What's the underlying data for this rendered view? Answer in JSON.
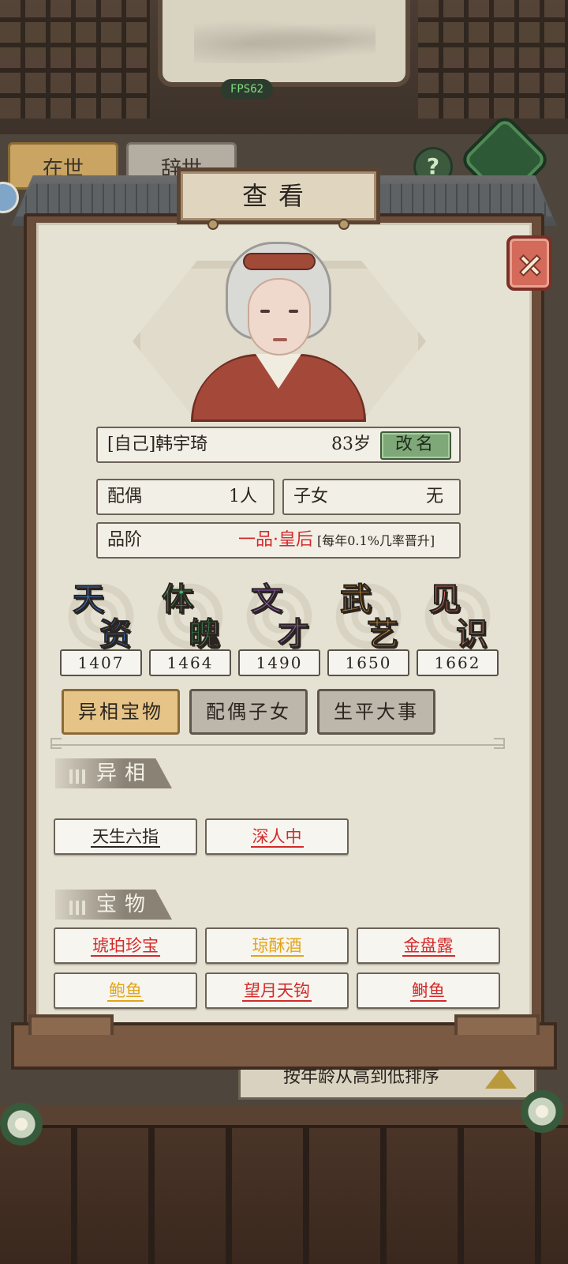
{
  "status": {
    "fps": "FPS62"
  },
  "background": {
    "tab_1": "在世",
    "tab_2": "辞世",
    "help_label": "?",
    "sort_label": "按年龄从高到低排序"
  },
  "modal": {
    "title": "查看",
    "character": {
      "name": "[自己]韩宇琦",
      "age": "83岁",
      "rename_label": "改名",
      "spouse_label": "配偶",
      "spouse_value": "1人",
      "children_label": "子女",
      "children_value": "无",
      "rank_label": "品阶",
      "rank_value": "一品·皇后",
      "rank_note": "[每年0.1%几率晋升]"
    },
    "stats": [
      {
        "c1": "天",
        "c2": "资",
        "value": "1407",
        "color": "#3b7de0"
      },
      {
        "c1": "体",
        "c2": "魄",
        "value": "1464",
        "color": "#3fb56a"
      },
      {
        "c1": "文",
        "c2": "才",
        "value": "1490",
        "color": "#a060d8"
      },
      {
        "c1": "武",
        "c2": "艺",
        "value": "1650",
        "color": "#e0a03a"
      },
      {
        "c1": "见",
        "c2": "识",
        "value": "1662",
        "color": "#e07a6a"
      }
    ],
    "tabs": [
      "异相宝物",
      "配偶子女",
      "生平大事"
    ],
    "sections": {
      "traits_title": "异相",
      "traits": [
        {
          "text": "天生六指",
          "color": "#2b2520"
        },
        {
          "text": "深人中",
          "color": "#d32a2a"
        }
      ],
      "treasures_title": "宝物",
      "treasures": [
        {
          "text": "琥珀珍宝",
          "color": "#d32a2a"
        },
        {
          "text": "琼酥酒",
          "color": "#e3a516"
        },
        {
          "text": "金盘露",
          "color": "#d32a2a"
        },
        {
          "text": "鲍鱼",
          "color": "#e3a516"
        },
        {
          "text": "望月天钩",
          "color": "#d32a2a"
        },
        {
          "text": "鲥鱼",
          "color": "#d32a2a"
        }
      ]
    }
  }
}
